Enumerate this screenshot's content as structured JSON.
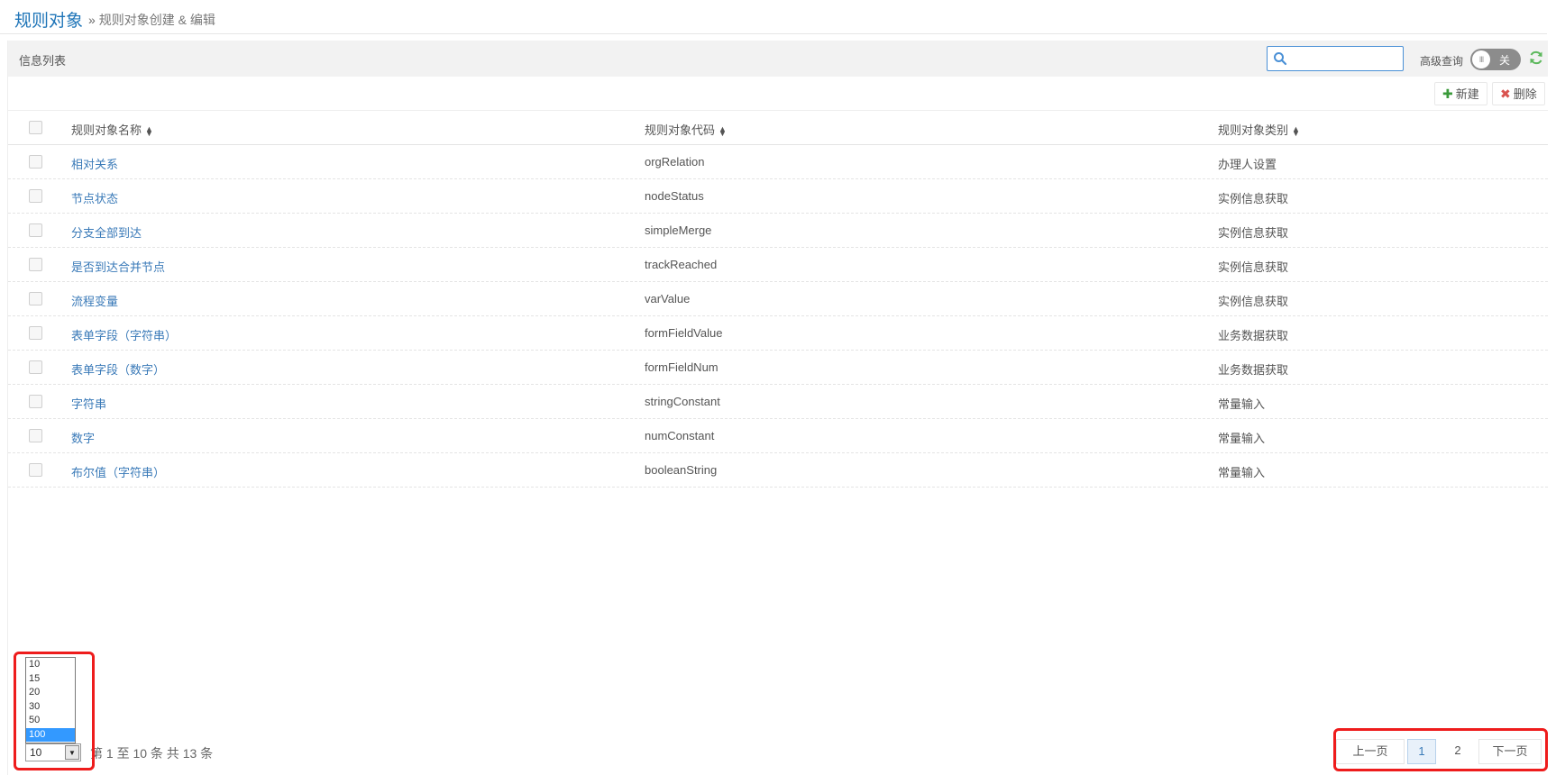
{
  "header": {
    "title": "规则对象",
    "breadcrumb_sep": "»",
    "breadcrumb": "规则对象创建 & 编辑"
  },
  "panel": {
    "title": "信息列表",
    "search": {
      "value": "",
      "placeholder": ""
    },
    "advanced_label": "高级查询",
    "toggle_state": "关",
    "toggle_knob": "III"
  },
  "toolbar": {
    "new_icon": "✚",
    "new_label": "新建",
    "delete_icon": "✖",
    "delete_label": "删除"
  },
  "table": {
    "columns": [
      "规则对象名称",
      "规则对象代码",
      "规则对象类别"
    ],
    "rows": [
      {
        "name": "相对关系",
        "code": "orgRelation",
        "category": "办理人设置"
      },
      {
        "name": "节点状态",
        "code": "nodeStatus",
        "category": "实例信息获取"
      },
      {
        "name": "分支全部到达",
        "code": "simpleMerge",
        "category": "实例信息获取"
      },
      {
        "name": "是否到达合并节点",
        "code": "trackReached",
        "category": "实例信息获取"
      },
      {
        "name": "流程变量",
        "code": "varValue",
        "category": "实例信息获取"
      },
      {
        "name": "表单字段（字符串）",
        "code": "formFieldValue",
        "category": "业务数据获取"
      },
      {
        "name": "表单字段（数字）",
        "code": "formFieldNum",
        "category": "业务数据获取"
      },
      {
        "name": "字符串",
        "code": "stringConstant",
        "category": "常量输入"
      },
      {
        "name": "数字",
        "code": "numConstant",
        "category": "常量输入"
      },
      {
        "name": "布尔值（字符串）",
        "code": "booleanString",
        "category": "常量输入"
      }
    ]
  },
  "page_size": {
    "selected": "10",
    "options": [
      "10",
      "15",
      "20",
      "30",
      "50",
      "100"
    ],
    "highlighted": "100"
  },
  "pager": {
    "info": "第 1 至 10 条 共 13 条",
    "prev": "上一页",
    "pages": [
      "1",
      "2"
    ],
    "current": "1",
    "next": "下一页"
  },
  "colors": {
    "accent": "#1f75b8",
    "link": "#3a7ab8",
    "highlight_box": "#ee1c1c"
  }
}
